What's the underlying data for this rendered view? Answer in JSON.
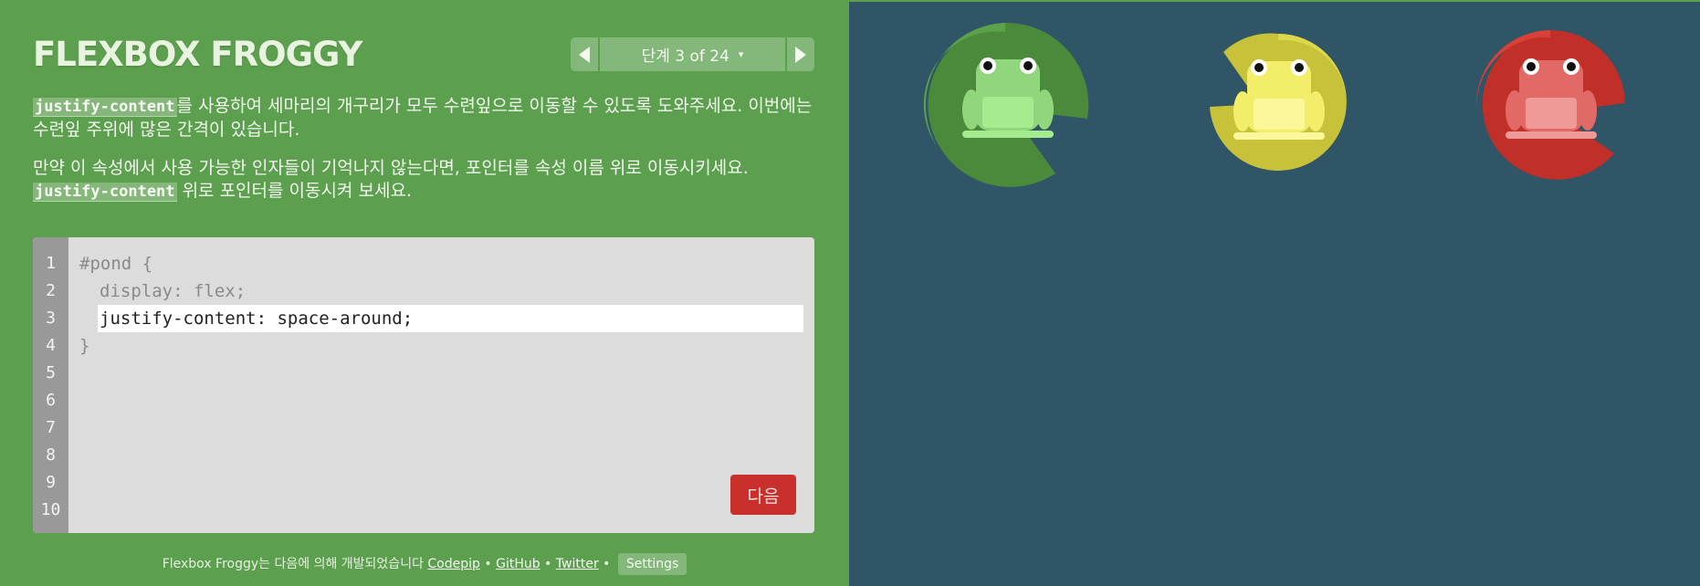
{
  "app": {
    "logo": "FLEXBOX FROGGY"
  },
  "level_nav": {
    "label": "단계 3 of 24",
    "caret": "▾"
  },
  "instructions": {
    "p1_code": "justify-content",
    "p1_text": "를 사용하여 세마리의 개구리가 모두 수련잎으로 이동할 수 있도록 도와주세요. 이번에는 수련잎 주위에 많은 간격이 있습니다.",
    "p2_text": "만약 이 속성에서 사용 가능한 인자들이 기억나지 않는다면, 포인터를 속성 이름 위로 이동시키세요.",
    "p2_code": "justify-content",
    "p2_tail": " 위로 포인터를 이동시켜 보세요."
  },
  "editor": {
    "line_numbers": [
      "1",
      "2",
      "3",
      "4",
      "5",
      "6",
      "7",
      "8",
      "9",
      "10"
    ],
    "line1": "#pond {",
    "line2": "display: flex;",
    "input_value": "justify-content: space-around;",
    "line4": "}",
    "next_label": "다음"
  },
  "credits": {
    "text": "Flexbox Froggy는 다음에 의해 개발되었습니다 ",
    "link1": "Codepip",
    "sep": " • ",
    "link2": "GitHub",
    "link3": "Twitter",
    "settings": "Settings"
  },
  "pond": {
    "background": "#2f5566",
    "frogs": [
      {
        "color": "green",
        "pad": "#4a8a3a",
        "pad_light": "#5aa149",
        "body": "#8fd67c",
        "belly": "#a5ec8e"
      },
      {
        "color": "yellow",
        "pad": "#c8c23a",
        "pad_light": "#ddd84a",
        "body": "#f2ee6a",
        "belly": "#fbf79a"
      },
      {
        "color": "red",
        "pad": "#c03028",
        "pad_light": "#da4036",
        "body": "#e26a66",
        "belly": "#ef9a96"
      }
    ]
  }
}
